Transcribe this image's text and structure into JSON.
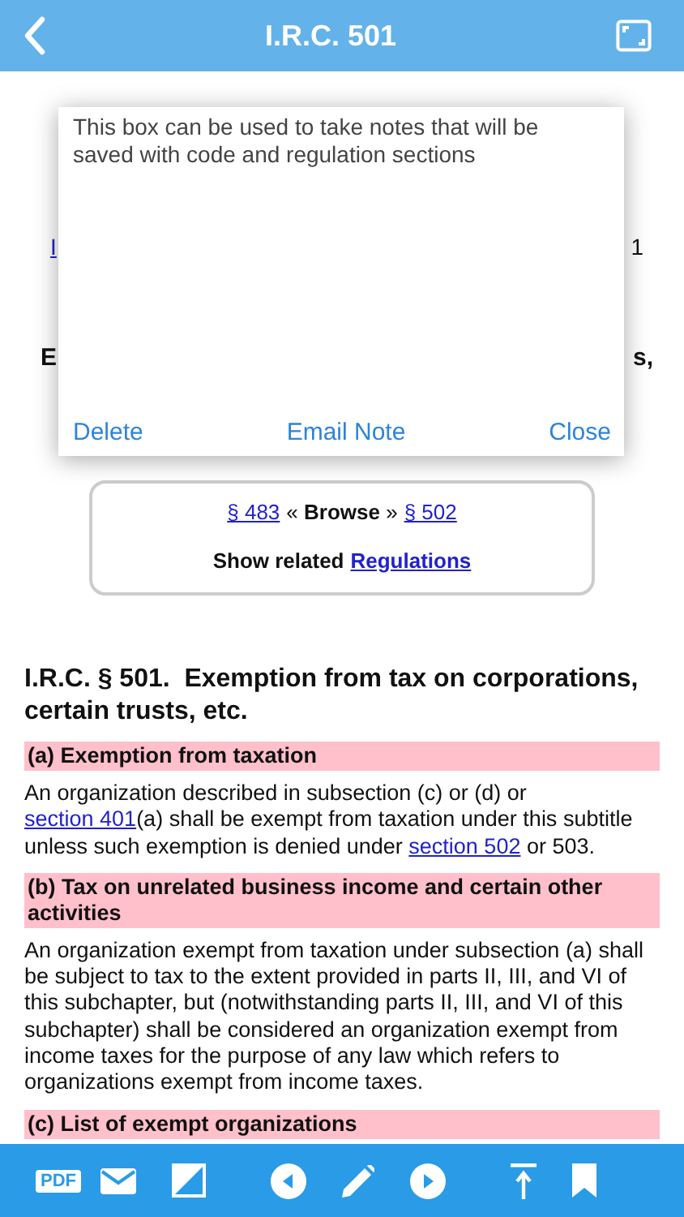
{
  "header": {
    "title": "I.R.C. 501"
  },
  "covered_rows": [
    {
      "left": {
        "text": "I",
        "kind": "link"
      },
      "right": {
        "text": "1",
        "kind": "plain"
      }
    },
    {
      "left": {
        "text": "E",
        "kind": "bold"
      },
      "right": {
        "text": "s,",
        "kind": "bold"
      }
    }
  ],
  "note_popup": {
    "text": "This box can be used to take notes that will be saved with code and regulation sections",
    "buttons": [
      "Delete",
      "Email Note",
      "Close"
    ]
  },
  "browse": {
    "prev": "§ 483",
    "middle": "« **Browse** »",
    "next": "§ 502",
    "related_label": "Show related",
    "related_link": "Regulations"
  },
  "section_title": "I.R.C. § 501.  Exemption from tax on corporations, certain trusts, etc.",
  "subsections": [
    {
      "heading": "(a) Exemption from taxation",
      "paragraph": [
        {
          "text": "An organization described in subsection (c) or (d) or ",
          "kind": "text"
        },
        {
          "text": "section 401",
          "kind": "link"
        },
        {
          "text": "(a) shall be exempt from taxation under this subtitle unless such exemption is denied under ",
          "kind": "text"
        },
        {
          "text": "section 502",
          "kind": "link"
        },
        {
          "text": " or 503.",
          "kind": "text"
        }
      ]
    },
    {
      "heading": "(b) Tax on unrelated business income and certain other activities",
      "paragraph": [
        {
          "text": "An organization exempt from taxation under subsection (a) shall be subject to tax to the extent provided in parts II, III, and VI of this subchapter, but (notwithstanding parts II, III, and VI of this subchapter) shall be considered an organization exempt from income taxes for the purpose of any law which refers to organizations exempt from income taxes.",
          "kind": "text"
        }
      ]
    },
    {
      "heading": "(c) List of exempt organizations"
    }
  ],
  "toolbar": {
    "pdf_label": "PDF"
  }
}
